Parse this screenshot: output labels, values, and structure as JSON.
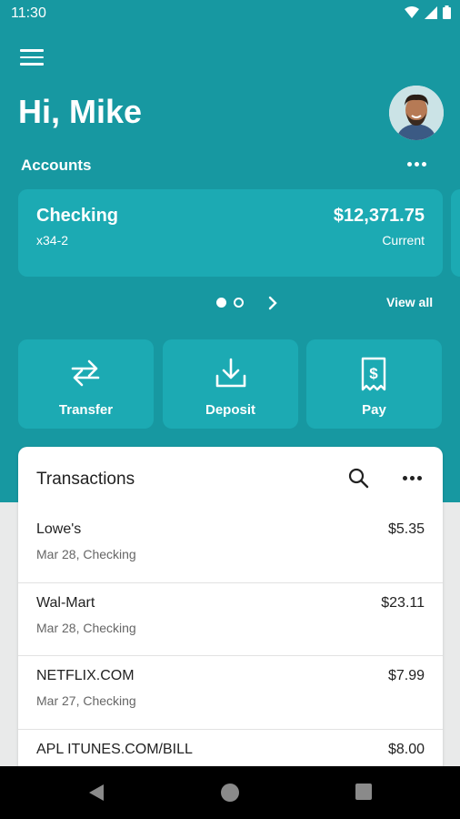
{
  "status": {
    "time": "11:30"
  },
  "header": {
    "greeting": "Hi, Mike"
  },
  "accounts": {
    "label": "Accounts",
    "cards": [
      {
        "name": "Checking",
        "number": "x34-2",
        "balance": "$12,371.75",
        "type": "Current"
      }
    ],
    "view_all": "View all",
    "page_count": 2,
    "active_page": 1
  },
  "actions": [
    {
      "label": "Transfer",
      "icon": "transfer-icon"
    },
    {
      "label": "Deposit",
      "icon": "deposit-icon"
    },
    {
      "label": "Pay",
      "icon": "pay-icon"
    }
  ],
  "transactions": {
    "title": "Transactions",
    "items": [
      {
        "merchant": "Lowe's",
        "meta": "Mar 28, Checking",
        "amount": "$5.35"
      },
      {
        "merchant": "Wal-Mart",
        "meta": "Mar 28, Checking",
        "amount": "$23.11"
      },
      {
        "merchant": "NETFLIX.COM",
        "meta": "Mar 27, Checking",
        "amount": "$7.99"
      },
      {
        "merchant": "APL ITUNES.COM/BILL",
        "meta": "",
        "amount": "$8.00"
      }
    ]
  },
  "colors": {
    "brand": "#1798a1",
    "card": "#1caab3",
    "background": "#e9eaea"
  },
  "icons": [
    "menu-icon",
    "avatar",
    "more-icon",
    "chevron-right-icon",
    "search-icon",
    "back-icon",
    "home-icon",
    "recents-icon",
    "wifi-icon",
    "signal-icon",
    "battery-icon"
  ]
}
